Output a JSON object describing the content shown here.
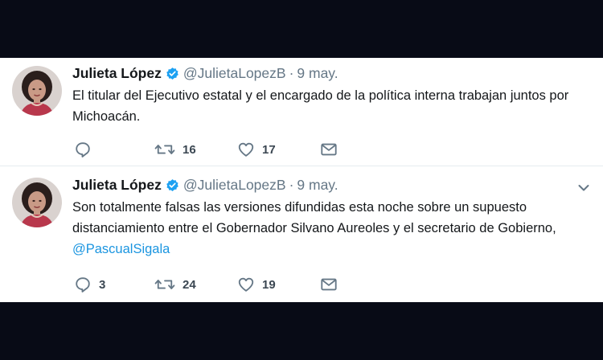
{
  "colors": {
    "background": "#080b16",
    "panel": "#ffffff",
    "text": "#14171a",
    "muted": "#657786",
    "link": "#1b95e0",
    "verified": "#1da1f2"
  },
  "tweets": [
    {
      "author_name": "Julieta López",
      "handle": "@JulietaLopezB",
      "separator": "·",
      "date": "9 may.",
      "text_parts": [
        "El titular del Ejecutivo estatal y el encargado de la política interna trabajan juntos por Michoacán.",
        ""
      ],
      "mention": "",
      "reply_count": "",
      "retweet_count": "16",
      "like_count": "17",
      "icons": [
        "verified-badge-icon",
        "reply-icon",
        "retweet-icon",
        "like-icon",
        "message-icon"
      ]
    },
    {
      "author_name": "Julieta López",
      "handle": "@JulietaLopezB",
      "separator": "·",
      "date": "9 may.",
      "text_parts": [
        "Son totalmente falsas las versiones difundidas esta noche sobre un supuesto distanciamiento entre el Gobernador Silvano Aureoles y el secretario de Gobierno, "
      ],
      "mention": "@PascualSigala",
      "reply_count": "3",
      "retweet_count": "24",
      "like_count": "19",
      "icons": [
        "verified-badge-icon",
        "chevron-down-icon",
        "reply-icon",
        "retweet-icon",
        "like-icon",
        "message-icon"
      ]
    }
  ]
}
